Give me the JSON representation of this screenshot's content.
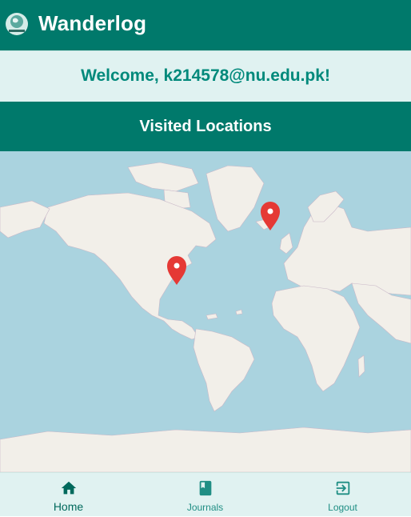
{
  "app": {
    "title": "Wanderlog",
    "logo_text": "Wanderlog"
  },
  "welcome": {
    "text": "Welcome, k214578@nu.edu.pk!"
  },
  "section": {
    "title": "Visited Locations"
  },
  "map": {
    "markers": [
      {
        "name": "marker-north-america",
        "color": "#e53935"
      },
      {
        "name": "marker-north-atlantic",
        "color": "#e53935"
      }
    ]
  },
  "nav": {
    "items": [
      {
        "label": "Home",
        "icon": "home-icon",
        "active": true
      },
      {
        "label": "Journals",
        "icon": "book-icon",
        "active": false
      },
      {
        "label": "Logout",
        "icon": "logout-icon",
        "active": false
      }
    ]
  },
  "colors": {
    "primary": "#00796b",
    "light": "#e0f2f1",
    "accent": "#00897b",
    "marker": "#e53935",
    "ocean": "#aad3df",
    "land": "#f2efe9"
  }
}
